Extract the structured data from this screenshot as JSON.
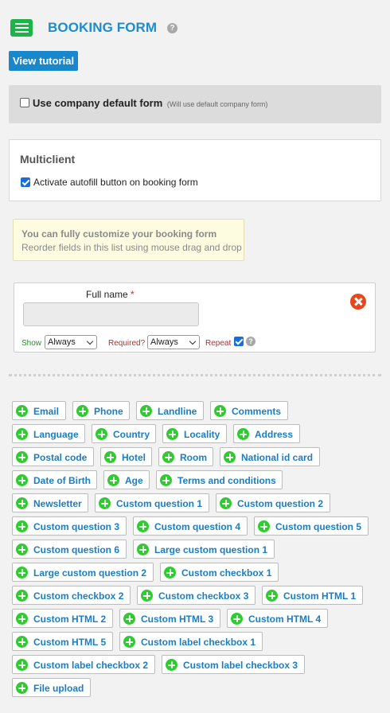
{
  "header": {
    "title": "BOOKING FORM",
    "title_icon": "booking-form-icon",
    "help_icon": "help-icon",
    "help_glyph": "?"
  },
  "tutorial_button": "View tutorial",
  "company_default": {
    "label": "Use company default form",
    "hint": "(Will use default company form)",
    "checked": false
  },
  "multiclient": {
    "title": "Multiclient",
    "autofill_label": "Activate autofill button on booking form",
    "autofill_checked": true
  },
  "info": {
    "line1": "You can fully customize your booking form",
    "line2": "Reorder fields in this list using mouse drag and drop"
  },
  "field": {
    "label": "Full name",
    "required_mark": "*",
    "show_label": "Show",
    "show_value": "Always",
    "required_label": "Required?",
    "required_value": "Always",
    "repeat_label": "Repeat",
    "repeat_checked": true,
    "help_glyph": "?"
  },
  "available_fields": [
    [
      "Email",
      "Phone",
      "Landline",
      "Comments"
    ],
    [
      "Language",
      "Country",
      "Locality",
      "Address"
    ],
    [
      "Postal code",
      "Hotel",
      "Room",
      "National id card"
    ],
    [
      "Date of Birth",
      "Age",
      "Terms and conditions"
    ],
    [
      "Newsletter",
      "Custom question 1",
      "Custom question 2"
    ],
    [
      "Custom question 3",
      "Custom question 4",
      "Custom question 5"
    ],
    [
      "Custom question 6",
      "Large custom question 1"
    ],
    [
      "Large custom question 2",
      "Custom checkbox 1"
    ],
    [
      "Custom checkbox 2",
      "Custom checkbox 3",
      "Custom HTML 1"
    ],
    [
      "Custom HTML 2",
      "Custom HTML 3",
      "Custom HTML 4"
    ],
    [
      "Custom HTML 5",
      "Custom label checkbox 1"
    ],
    [
      "Custom label checkbox 2",
      "Custom label checkbox 3"
    ],
    [
      "File upload"
    ]
  ],
  "colors": {
    "accent": "#1d8ccf",
    "add_icon": "#2fcc2f",
    "remove_icon": "#e8471d"
  }
}
